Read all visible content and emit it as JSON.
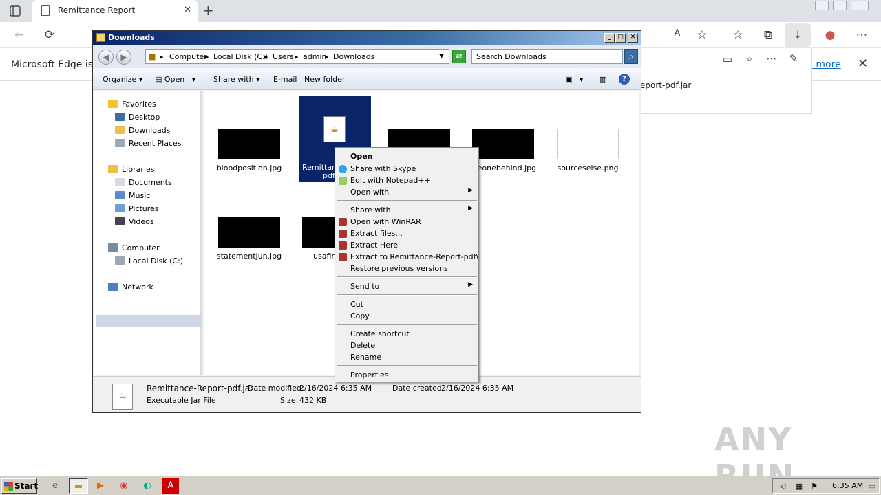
{
  "browser": {
    "tab_title": "Remittance Report",
    "tab_close": "✕",
    "new_tab": "+",
    "infobar_text": "Microsoft Edge is no",
    "learn_more": "arn more",
    "download_item": "eport-pdf.jar"
  },
  "explorer": {
    "title": "Downloads",
    "breadcrumbs": [
      "Computer",
      "Local Disk (C:)",
      "Users",
      "admin",
      "Downloads"
    ],
    "search_placeholder": "Search Downloads",
    "toolbar": {
      "organize": "Organize",
      "open": "Open",
      "share_with": "Share with",
      "email": "E-mail",
      "new_folder": "New folder"
    },
    "nav": {
      "favorites": "Favorites",
      "desktop": "Desktop",
      "downloads": "Downloads",
      "recent": "Recent Places",
      "libraries": "Libraries",
      "documents": "Documents",
      "music": "Music",
      "pictures": "Pictures",
      "videos": "Videos",
      "computer": "Computer",
      "local_disk": "Local Disk (C:)",
      "network": "Network"
    },
    "files": {
      "f1": "bloodposition.jpg",
      "f2_line1": "Remittanc",
      "f2_line2": "pdf",
      "f3": "meonebehind.jpg",
      "f4": "sourceselse.png",
      "f5": "statementjun.jpg",
      "f6": "usafir"
    },
    "details": {
      "name": "Remittance-Report-pdf.jar",
      "type": "Executable Jar File",
      "modified_label": "Date modified:",
      "modified_value": "2/16/2024 6:35 AM",
      "created_label": "Date created:",
      "created_value": "2/16/2024 6:35 AM",
      "size_label": "Size:",
      "size_value": "432 KB"
    }
  },
  "context_menu": {
    "open": "Open",
    "share_skype": "Share with Skype",
    "edit_npp": "Edit with Notepad++",
    "open_with": "Open with",
    "share_with": "Share with",
    "open_winrar": "Open with WinRAR",
    "extract_files": "Extract files...",
    "extract_here": "Extract Here",
    "extract_to": "Extract to Remittance-Report-pdf\\",
    "restore": "Restore previous versions",
    "send_to": "Send to",
    "cut": "Cut",
    "copy": "Copy",
    "create_shortcut": "Create shortcut",
    "delete": "Delete",
    "rename": "Rename",
    "properties": "Properties"
  },
  "taskbar": {
    "start": "Start",
    "clock": "6:35 AM"
  },
  "watermark": "ANY RUN",
  "colors": {
    "selection": "#0a246a",
    "title_gradient_start": "#0a246a",
    "edge_link": "#0f6cbd"
  }
}
